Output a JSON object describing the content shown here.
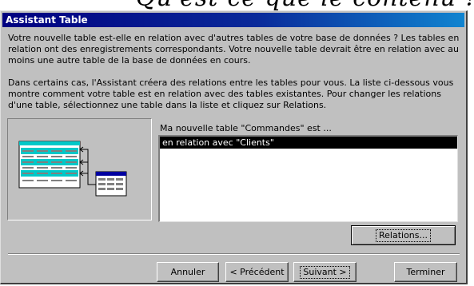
{
  "window": {
    "title": "Assistant Table"
  },
  "top_text": "Qu'est-ce que le contenu ?",
  "intro": {
    "paragraph1": "Votre nouvelle table est-elle en relation avec d'autres tables de votre base de données ? Les tables en relation ont des enregistrements correspondants. Votre nouvelle table devrait être en relation avec au moins une autre table de la base de données en cours.",
    "paragraph2": "Dans certains cas, l'Assistant créera des relations entre les tables pour vous. La liste ci-dessous vous montre comment votre table est en relation avec des tables existantes. Pour changer les relations d'une table, sélectionnez une table dans la liste et cliquez sur Relations."
  },
  "list": {
    "label": "Ma nouvelle table \"Commandes\" est ...",
    "items": [
      {
        "label": "en relation avec \"Clients\"",
        "selected": true
      }
    ]
  },
  "buttons": {
    "relations": "Relations...",
    "annuler": "Annuler",
    "precedent": "< Précédent",
    "suivant": "Suivant >",
    "terminer": "Terminer"
  },
  "colors": {
    "title_bar": "#000080",
    "face": "#c0c0c0",
    "illustration_accent": "#00c8c8"
  }
}
